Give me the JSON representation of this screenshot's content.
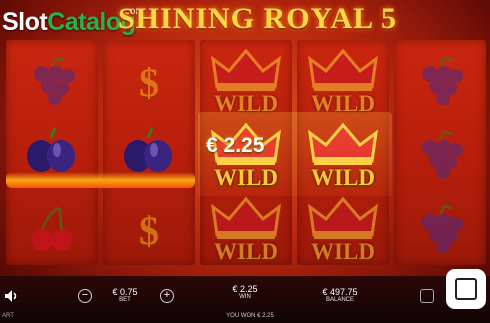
{
  "header": {
    "title": "SHINING ROYAL 5",
    "watermark_main": "Slot",
    "watermark_accent": "Catalog",
    "watermark_com": ".com"
  },
  "reels": [
    [
      "grapes",
      "plum-fire",
      "cherries"
    ],
    [
      "dollar",
      "plum-fire",
      "dollar"
    ],
    [
      "wild",
      "wild",
      "wild"
    ],
    [
      "wild",
      "wild",
      "wild"
    ],
    [
      "grapes",
      "grapes",
      "grapes"
    ]
  ],
  "symbols": {
    "wild_label": "WILD",
    "dollar_glyph": "$"
  },
  "win_overlay": {
    "amount": "€ 2.25"
  },
  "bottom": {
    "bet_value": "€ 0.75",
    "bet_label": "BET",
    "win_value": "€ 2.25",
    "win_label": "WIN",
    "balance_value": "€ 497.75",
    "balance_label": "BALANCE",
    "won_message": "YOU WON € 2.25",
    "minus_glyph": "−",
    "plus_glyph": "+",
    "brand": "ART"
  },
  "colors": {
    "gold": "#ffce3a",
    "reel_red": "#c9260e",
    "grape_purple": "#4a2a8a",
    "cherry_red": "#d8102a"
  }
}
